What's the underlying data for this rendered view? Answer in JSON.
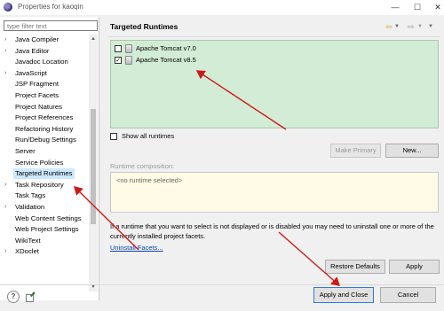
{
  "window": {
    "title": "Properties for kaoqin",
    "controls": {
      "minimize": "—",
      "maximize": "☐",
      "close": "✕"
    }
  },
  "sidebar": {
    "filter_placeholder": "type filter text",
    "items": [
      {
        "label": "Java Compiler",
        "expandable": true
      },
      {
        "label": "Java Editor",
        "expandable": true
      },
      {
        "label": "Javadoc Location",
        "expandable": false
      },
      {
        "label": "JavaScript",
        "expandable": true
      },
      {
        "label": "JSP Fragment",
        "expandable": false
      },
      {
        "label": "Project Facets",
        "expandable": false
      },
      {
        "label": "Project Natures",
        "expandable": false
      },
      {
        "label": "Project References",
        "expandable": false
      },
      {
        "label": "Refactoring History",
        "expandable": false
      },
      {
        "label": "Run/Debug Settings",
        "expandable": false
      },
      {
        "label": "Server",
        "expandable": false
      },
      {
        "label": "Service Policies",
        "expandable": false
      },
      {
        "label": "Targeted Runtimes",
        "expandable": false,
        "selected": true
      },
      {
        "label": "Task Repository",
        "expandable": true
      },
      {
        "label": "Task Tags",
        "expandable": false
      },
      {
        "label": "Validation",
        "expandable": true
      },
      {
        "label": "Web Content Settings",
        "expandable": false
      },
      {
        "label": "Web Project Settings",
        "expandable": false
      },
      {
        "label": "WikiText",
        "expandable": false
      },
      {
        "label": "XDoclet",
        "expandable": true
      }
    ]
  },
  "main": {
    "title": "Targeted Runtimes",
    "runtimes": [
      {
        "label": "Apache Tomcat v7.0",
        "checked": false
      },
      {
        "label": "Apache Tomcat v8.5",
        "checked": true
      }
    ],
    "show_all_label": "Show all runtimes",
    "make_primary_label": "Make Primary",
    "new_label": "New...",
    "composition_label": "Runtime composition:",
    "composition_empty": "<no runtime selected>",
    "info_text": "If a runtime that you want to select is not displayed or is disabled you may need to uninstall one or more of the currently installed project facets.",
    "uninstall_link": "Uninstall Facets...",
    "restore_defaults_label": "Restore Defaults",
    "apply_label": "Apply"
  },
  "footer": {
    "apply_close_label": "Apply and Close",
    "cancel_label": "Cancel"
  },
  "colors": {
    "runtime_list_bg": "#d2ecd6",
    "composition_bg": "#fffbe6",
    "selection": "#cce8ff",
    "annotation_arrow": "#cc1a1a",
    "link": "#0645ad"
  }
}
